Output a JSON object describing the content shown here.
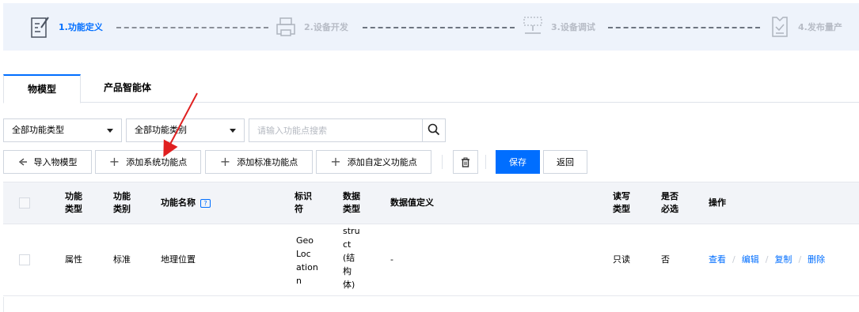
{
  "stepper": {
    "steps": [
      {
        "label": "1.功能定义",
        "state": "active",
        "icon": "document-edit-icon"
      },
      {
        "label": "2.设备开发",
        "state": "inactive",
        "icon": "device-printer-icon"
      },
      {
        "label": "3.设备调试",
        "state": "inactive",
        "icon": "debug-frame-icon"
      },
      {
        "label": "4.发布量产",
        "state": "inactive",
        "icon": "clipboard-check-icon"
      }
    ]
  },
  "tabs": [
    {
      "label": "物模型",
      "active": true
    },
    {
      "label": "产品智能体",
      "active": false
    }
  ],
  "filters": {
    "type_select": "全部功能类型",
    "category_select": "全部功能类别",
    "search_placeholder": "请输入功能点搜索"
  },
  "toolbar": {
    "import_label": "导入物模型",
    "add_system_label": "添加系统功能点",
    "add_standard_label": "添加标准功能点",
    "add_custom_label": "添加自定义功能点",
    "delete_icon": "trash-icon",
    "save_label": "保存",
    "back_label": "返回"
  },
  "table": {
    "headers": {
      "func_type": "功能\n类型",
      "func_category": "功能\n类别",
      "func_name": "功能名称",
      "help_mark": "?",
      "identifier": "标识\n符",
      "data_type": "数据\n类型",
      "data_def": "数据值定义",
      "rw_type": "读写\n类型",
      "required": "是否\n必选",
      "actions": "操作"
    },
    "rows": [
      {
        "func_type": "属性",
        "func_category": "标准",
        "func_name": "地理位置",
        "identifier": "Geo\nLoc\nation\nn",
        "data_type": "stru\nct\n(结\n构\n体)",
        "data_def": "-",
        "rw_type": "只读",
        "required": "否",
        "actions": {
          "view": "查看",
          "edit": "编辑",
          "copy": "复制",
          "delete": "删除"
        }
      }
    ]
  },
  "colors": {
    "accent": "#006eff",
    "stepper_bg": "#eef3fb",
    "header_bg": "#f2f4f8",
    "annotation_arrow": "#e02020"
  }
}
